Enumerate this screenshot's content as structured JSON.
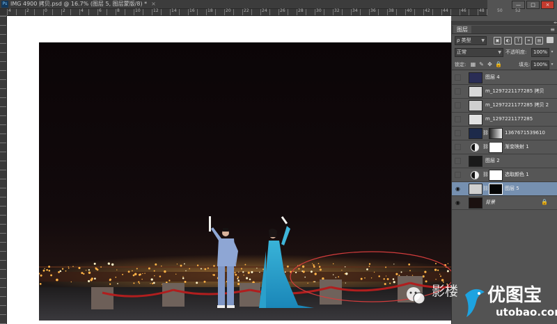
{
  "document": {
    "title": "IMG 4900 拷贝.psd @ 16.7% (图层 5, 图层蒙版/8) *",
    "close_glyph": "×",
    "ruler_ticks": [
      "4",
      "2",
      "0",
      "2",
      "4",
      "6",
      "8",
      "10",
      "12",
      "14",
      "16",
      "18",
      "20",
      "22",
      "24",
      "26",
      "28",
      "30",
      "32",
      "34",
      "36",
      "38",
      "40",
      "42",
      "44",
      "46",
      "48",
      "50",
      "52"
    ]
  },
  "window_controls": {
    "minimize": "—",
    "maximize": "□",
    "close": "×"
  },
  "layers_panel": {
    "collapse_glyph": "◂◂",
    "tab_label": "图层",
    "filter_kind": "ρ 类型",
    "blend_mode": "正常",
    "opacity_label": "不透明度:",
    "opacity_value": "100%",
    "lock_label": "锁定:",
    "fill_label": "填充:",
    "fill_value": "100%",
    "layers": [
      {
        "name": "图层 4",
        "visible": false,
        "kind": "pixel",
        "thumb": "#2a2d55"
      },
      {
        "name": "m_1297221177285 拷贝",
        "visible": false,
        "kind": "pixel",
        "thumb": "#d8d8d8"
      },
      {
        "name": "m_1297221177285 拷贝 2",
        "visible": false,
        "kind": "pixel",
        "thumb": "#cfcfcf"
      },
      {
        "name": "m_1297221177285",
        "visible": false,
        "kind": "pixel",
        "thumb": "#e2e2e2"
      },
      {
        "name": "1367671539610",
        "visible": false,
        "kind": "masked",
        "thumb": "#1d2a4a"
      },
      {
        "name": "渐变映射 1",
        "visible": false,
        "kind": "adjustment"
      },
      {
        "name": "图层 2",
        "visible": false,
        "kind": "pixel",
        "thumb": "#1a1a1a"
      },
      {
        "name": "选取颜色 1",
        "visible": false,
        "kind": "adjustment"
      },
      {
        "name": "图层 5",
        "visible": true,
        "kind": "masked-selected",
        "thumb": "#cfcfcf",
        "selected": true
      },
      {
        "name": "背景",
        "visible": true,
        "kind": "background",
        "thumb": "#1b1110",
        "locked": true
      }
    ]
  },
  "watermark": {
    "left_text": "影楼",
    "brand_text": "优图宝",
    "brand_url": "utobao.com"
  },
  "colors": {
    "annotation_red": "#d23c3c",
    "selected_layer": "#7690b0",
    "panel_bg": "#535353"
  }
}
